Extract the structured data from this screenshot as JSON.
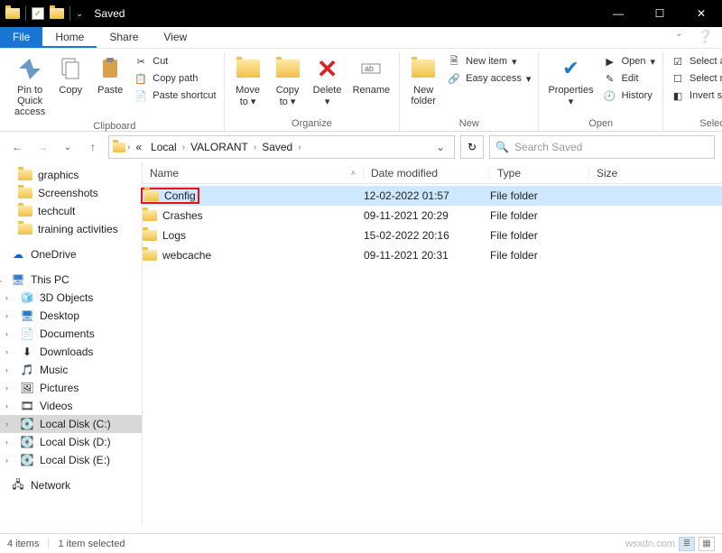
{
  "window": {
    "title": "Saved"
  },
  "tabs": {
    "file": "File",
    "home": "Home",
    "share": "Share",
    "view": "View"
  },
  "ribbon": {
    "pin": "Pin to Quick\naccess",
    "copy": "Copy",
    "paste": "Paste",
    "cut": "Cut",
    "copy_path": "Copy path",
    "paste_shortcut": "Paste shortcut",
    "move_to": "Move\nto",
    "copy_to": "Copy\nto",
    "delete": "Delete",
    "rename": "Rename",
    "new_folder": "New\nfolder",
    "new_item": "New item",
    "easy_access": "Easy access",
    "properties": "Properties",
    "open": "Open",
    "edit": "Edit",
    "history": "History",
    "select_all": "Select all",
    "select_none": "Select none",
    "invert_selection": "Invert selection",
    "groups": {
      "clipboard": "Clipboard",
      "organize": "Organize",
      "new": "New",
      "open": "Open",
      "select": "Select"
    }
  },
  "breadcrumb": {
    "items": [
      "Local",
      "VALORANT",
      "Saved"
    ]
  },
  "search": {
    "placeholder": "Search Saved"
  },
  "columns": {
    "name": "Name",
    "date": "Date modified",
    "type": "Type",
    "size": "Size"
  },
  "files": [
    {
      "name": "Config",
      "date": "12-02-2022 01:57",
      "type": "File folder"
    },
    {
      "name": "Crashes",
      "date": "09-11-2021 20:29",
      "type": "File folder"
    },
    {
      "name": "Logs",
      "date": "15-02-2022 20:16",
      "type": "File folder"
    },
    {
      "name": "webcache",
      "date": "09-11-2021 20:31",
      "type": "File folder"
    }
  ],
  "sidebar": {
    "quick": {
      "graphics": "graphics",
      "screenshots": "Screenshots",
      "techcult": "techcult",
      "training": "training activities"
    },
    "onedrive": "OneDrive",
    "thispc": "This PC",
    "pc": {
      "objects3d": "3D Objects",
      "desktop": "Desktop",
      "documents": "Documents",
      "downloads": "Downloads",
      "music": "Music",
      "pictures": "Pictures",
      "videos": "Videos",
      "localc": "Local Disk (C:)",
      "locald": "Local Disk (D:)",
      "locale": "Local Disk (E:)"
    },
    "network": "Network"
  },
  "status": {
    "items": "4 items",
    "selected": "1 item selected",
    "watermark": "wsxdn.com"
  }
}
